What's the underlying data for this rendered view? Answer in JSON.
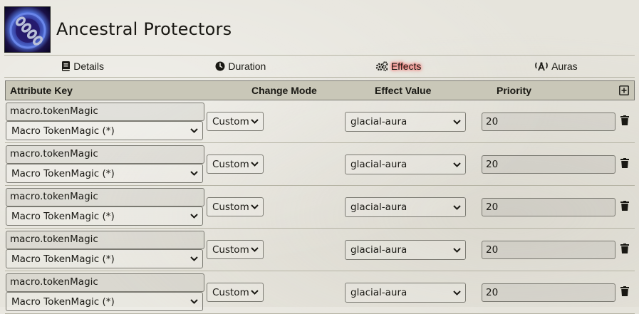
{
  "header": {
    "title": "Ancestral Protectors"
  },
  "tabs": [
    {
      "label": "Details",
      "icon": "book-icon",
      "active": false
    },
    {
      "label": "Duration",
      "icon": "clock-icon",
      "active": false
    },
    {
      "label": "Effects",
      "icon": "cogs-icon",
      "active": true
    },
    {
      "label": "Auras",
      "icon": "broadcast-tower-icon",
      "active": false
    }
  ],
  "table": {
    "columns": {
      "key": "Attribute Key",
      "mode": "Change Mode",
      "value": "Effect Value",
      "priority": "Priority"
    },
    "add_icon": "plus-square-icon",
    "rows": [
      {
        "key": "macro.tokenMagic",
        "key_option": "Macro TokenMagic (*)",
        "mode": "Custom",
        "value": "glacial-aura",
        "priority": "20"
      },
      {
        "key": "macro.tokenMagic",
        "key_option": "Macro TokenMagic (*)",
        "mode": "Custom",
        "value": "glacial-aura",
        "priority": "20"
      },
      {
        "key": "macro.tokenMagic",
        "key_option": "Macro TokenMagic (*)",
        "mode": "Custom",
        "value": "glacial-aura",
        "priority": "20"
      },
      {
        "key": "macro.tokenMagic",
        "key_option": "Macro TokenMagic (*)",
        "mode": "Custom",
        "value": "glacial-aura",
        "priority": "20"
      },
      {
        "key": "macro.tokenMagic",
        "key_option": "Macro TokenMagic (*)",
        "mode": "Custom",
        "value": "glacial-aura",
        "priority": "20"
      }
    ]
  },
  "colors": {
    "active_glow": "#ff3c3c",
    "header_bg": "#c9c7b8",
    "border": "#7a7971"
  }
}
